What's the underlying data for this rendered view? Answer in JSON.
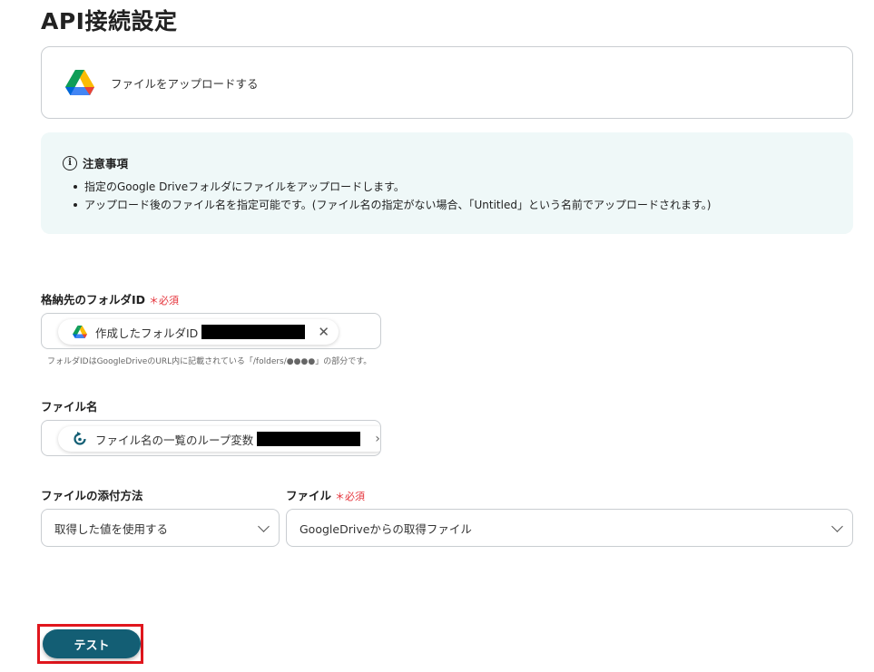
{
  "page": {
    "title": "API接続設定"
  },
  "action": {
    "label": "ファイルをアップロードする",
    "icon": "google-drive-icon"
  },
  "notice": {
    "title": "注意事項",
    "items": [
      "指定のGoogle Driveフォルダにファイルをアップロードします。",
      "アップロード後のファイル名を指定可能です。(ファイル名の指定がない場合、「Untitled」という名前でアップロードされます。)"
    ]
  },
  "folder_field": {
    "label": "格納先のフォルダID",
    "required": "＊必須",
    "chip_text": "作成したフォルダID",
    "hint": "フォルダIDはGoogleDriveのURL内に記載されている「/folders/●●●●」の部分です。"
  },
  "filename_field": {
    "label": "ファイル名",
    "chip_text": "ファイル名の一覧のループ変数"
  },
  "attach_method": {
    "label": "ファイルの添付方法",
    "value": "取得した値を使用する"
  },
  "file_field": {
    "label": "ファイル",
    "required": "＊必須",
    "value": "GoogleDriveからの取得ファイル"
  },
  "test_button": {
    "label": "テスト"
  },
  "colors": {
    "primary": "#135e74",
    "required": "#e5323a",
    "notice_bg": "#eff8f8",
    "highlight": "#e0161d"
  }
}
